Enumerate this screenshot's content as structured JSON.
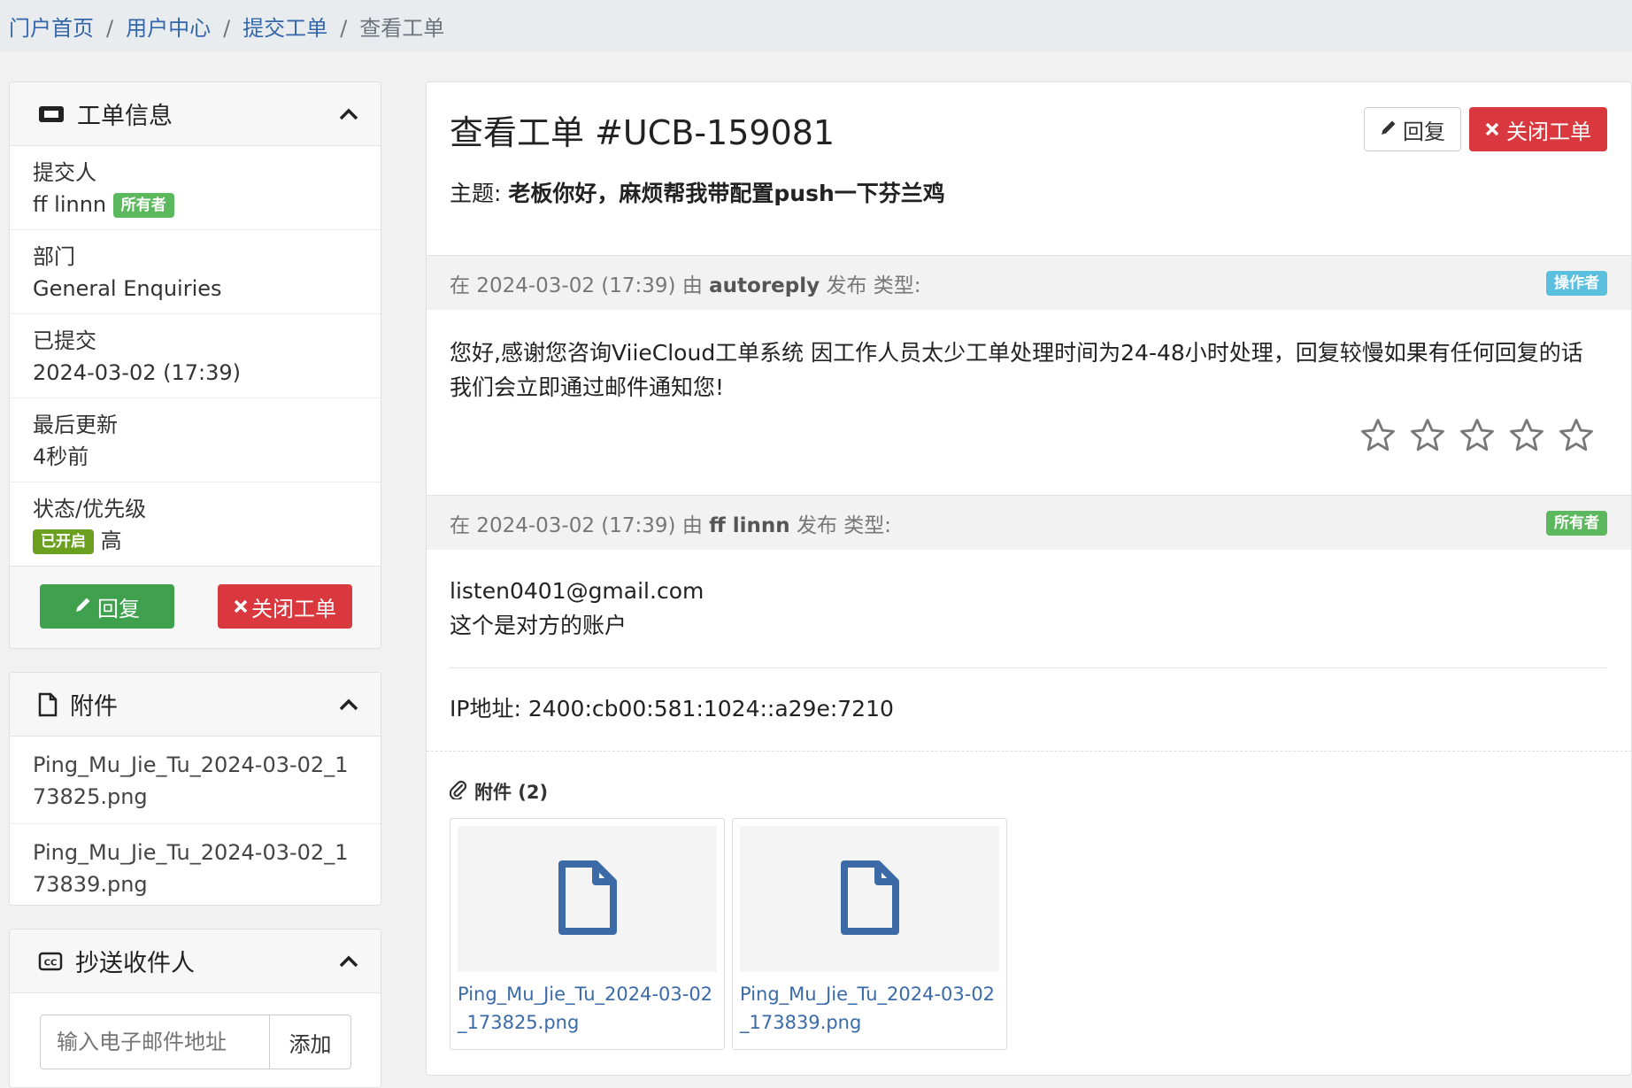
{
  "breadcrumb": {
    "items": [
      "门户首页",
      "用户中心",
      "提交工单"
    ],
    "separator": "/",
    "active": "查看工单"
  },
  "ticket_info": {
    "title": "工单信息",
    "submitter_label": "提交人",
    "submitter_name": "ff linnn",
    "submitter_badge": "所有者",
    "department_label": "部门",
    "department_value": "General Enquiries",
    "submitted_label": "已提交",
    "submitted_value": "2024-03-02 (17:39)",
    "updated_label": "最后更新",
    "updated_value": "4秒前",
    "status_label": "状态/优先级",
    "status_badge": "已开启",
    "priority": "高",
    "reply_button": "回复",
    "close_button": "关闭工单"
  },
  "attachments_panel": {
    "title": "附件",
    "files": [
      "Ping_Mu_Jie_Tu_2024-03-02_173825.png",
      "Ping_Mu_Jie_Tu_2024-03-02_173839.png"
    ]
  },
  "cc_panel": {
    "title": "抄送收件人",
    "email_placeholder": "输入电子邮件地址",
    "add_button": "添加"
  },
  "main": {
    "title": "查看工单 #UCB-159081",
    "reply_button": "回复",
    "close_button": "关闭工单",
    "subject_label": "主题:",
    "subject_value": "老板你好，麻烦帮我带配置push一下芬兰鸡",
    "messages": [
      {
        "prefix": "在 2024-03-02 (17:39) 由",
        "author": "autoreply",
        "suffix": "发布 类型:",
        "badge": "操作者",
        "body": "您好,感谢您咨询ViieCloud工单系统 因工作人员太少工单处理时间为24-48小时处理，回复较慢如果有任何回复的话 我们会立即通过邮件通知您!",
        "rating_stars": 5,
        "rating_value": 0
      },
      {
        "prefix": "在 2024-03-02 (17:39) 由",
        "author": "ff linnn",
        "suffix": "发布 类型:",
        "badge": "所有者",
        "body_line1": "listen0401@gmail.com",
        "body_line2": "这个是对方的账户",
        "ip_label": "IP地址:",
        "ip_value": "2400:cb00:581:1024::a29e:7210"
      }
    ],
    "attachments_title": "附件 (2)",
    "attachments": [
      "Ping_Mu_Jie_Tu_2024-03-02_173825.png",
      "Ping_Mu_Jie_Tu_2024-03-02_173839.png"
    ]
  },
  "colors": {
    "link": "#3366aa",
    "success": "#3fa14e",
    "danger": "#d9383e",
    "badge_owner": "#5cb85c",
    "badge_operator": "#5bc0de",
    "badge_open": "#6b9f1f"
  }
}
